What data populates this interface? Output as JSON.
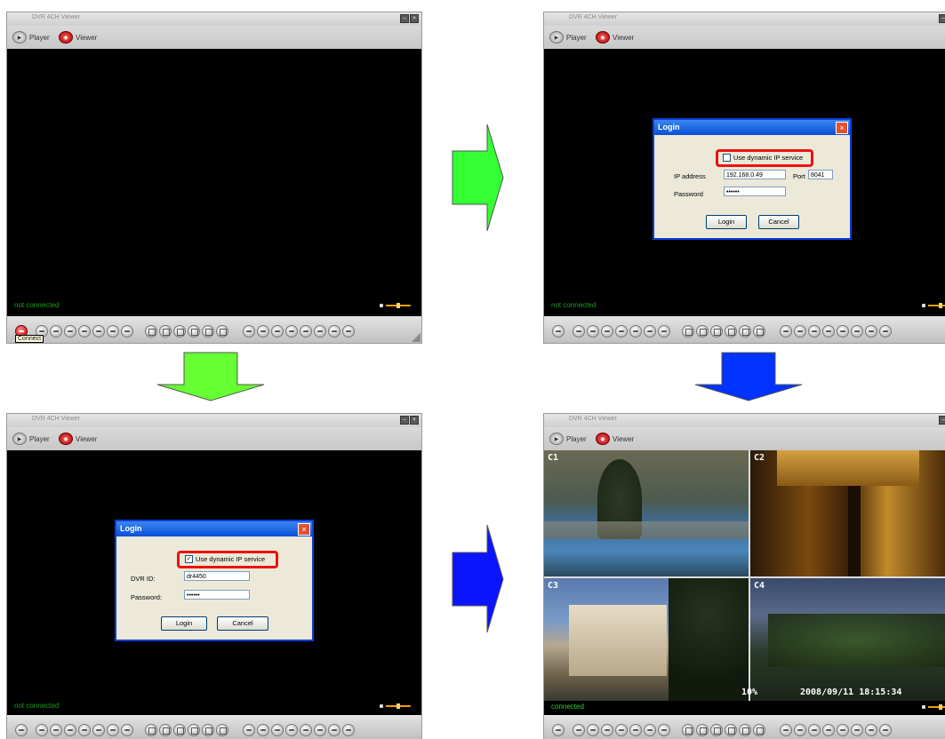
{
  "app": {
    "title": "DVR 4CH Viewer",
    "modes": {
      "player": "Player",
      "viewer": "Viewer"
    }
  },
  "panel1": {
    "status": "not connected",
    "tooltip": "Connect"
  },
  "panel2": {
    "status": "not connected",
    "dialog": {
      "title": "Login",
      "dynamic_ip_label": "Use dynamic IP service",
      "dynamic_ip_checked": false,
      "ip_label": "IP address",
      "ip_value": "192.168.0.49",
      "port_label": "Port",
      "port_value": "8041",
      "password_label": "Password",
      "password_value": "••••••",
      "login_button": "Login",
      "cancel_button": "Cancel"
    }
  },
  "panel3": {
    "status": "not connected",
    "dialog": {
      "title": "Login",
      "dynamic_ip_label": "Use dynamic IP service",
      "dynamic_ip_checked": true,
      "dvr_id_label": "DVR ID:",
      "dvr_id_value": "dr4450",
      "password_label": "Password:",
      "password_value": "••••••",
      "login_button": "Login",
      "cancel_button": "Cancel"
    }
  },
  "panel4": {
    "status": "connected",
    "cameras": [
      "C1",
      "C2",
      "C3",
      "C4"
    ],
    "osd_percent": "10%",
    "osd_datetime": "2008/09/11 18:15:34"
  },
  "arrows": {
    "panel1_to_panel3": "#66ff33",
    "panel1_to_panel2": "#33ff33",
    "panel2_to_panel4": "#0033ff",
    "panel3_to_panel4": "#0a14ff"
  }
}
